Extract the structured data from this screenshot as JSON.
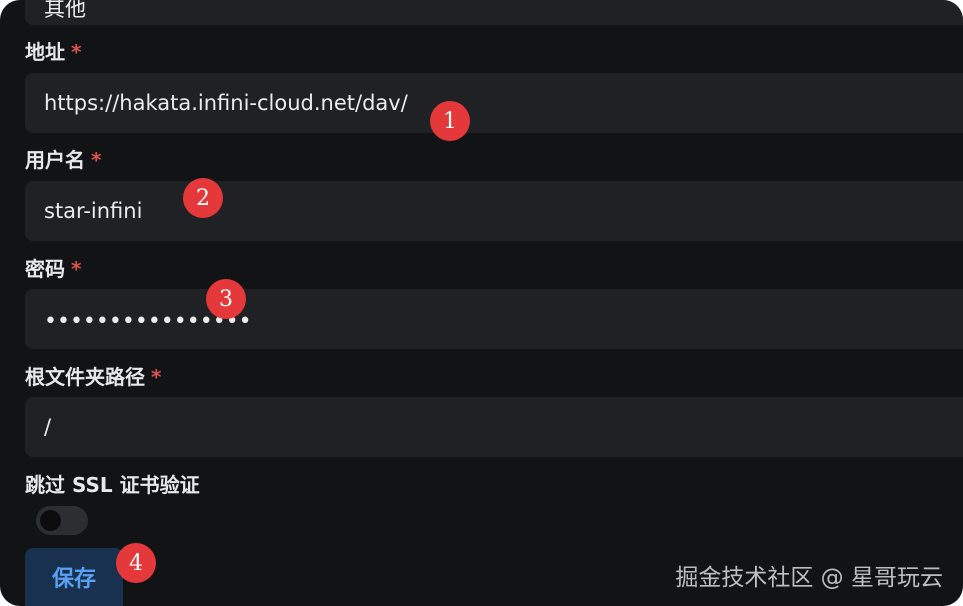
{
  "top_partial_field": {
    "value": "其他"
  },
  "fields": {
    "address": {
      "label": "地址",
      "required_mark": "*",
      "value": "https://hakata.infini-cloud.net/dav/"
    },
    "username": {
      "label": "用户名",
      "required_mark": "*",
      "value": "star-infini"
    },
    "password": {
      "label": "密码",
      "required_mark": "*",
      "value": "••••••••••••••••"
    },
    "root_folder": {
      "label": "根文件夹路径",
      "required_mark": "*",
      "value": "/"
    }
  },
  "skip_ssl": {
    "label": "跳过 SSL 证书验证",
    "enabled": false
  },
  "save_button": {
    "label": "保存"
  },
  "markers": [
    "1",
    "2",
    "3",
    "4"
  ],
  "watermark": "掘金技术社区 @ 星哥玩云",
  "colors": {
    "background": "#121315",
    "field_background": "#1f2124",
    "required": "#d9534f",
    "button_bg": "#17314f",
    "button_text": "#5aa0f2",
    "marker": "#e5383b"
  }
}
